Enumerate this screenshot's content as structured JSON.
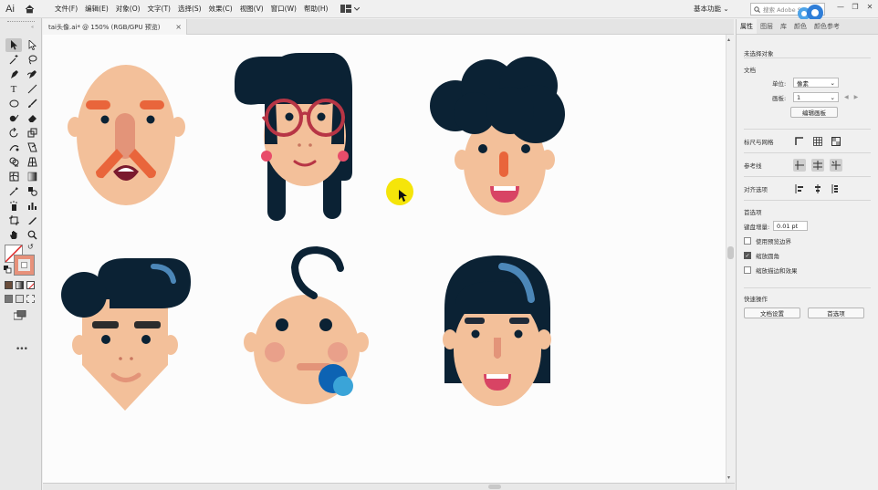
{
  "app": {
    "logo": "Ai"
  },
  "menu": [
    "文件(F)",
    "编辑(E)",
    "对象(O)",
    "文字(T)",
    "选择(S)",
    "效果(C)",
    "视图(V)",
    "窗口(W)",
    "帮助(H)"
  ],
  "workspace": {
    "label": "基本功能"
  },
  "search": {
    "placeholder": "搜索 Adobe Stock"
  },
  "document_tab": {
    "title": "tai头像.ai* @ 150% (RGB/GPU 预览)",
    "close": "×"
  },
  "panel": {
    "tabs": [
      "属性",
      "图层",
      "库",
      "颜色",
      "颜色参考"
    ],
    "selection_state": "未选择对象",
    "document": {
      "title": "文档",
      "units_label": "单位:",
      "units_value": "像素",
      "artboard_label": "画板:",
      "artboard_value": "1",
      "edit_artboards": "编辑画板"
    },
    "rulers_grids": "标尺与网格",
    "guides": "参考线",
    "align_to": "对齐选项",
    "preferences": {
      "title": "首选项",
      "key_increment_label": "键盘增量:",
      "key_increment_value": "0.01 pt",
      "use_preview_bounds": "使用预览边界",
      "scale_corners": "缩放圆角",
      "scale_strokes_effects": "缩放描边和效果"
    },
    "quick_actions": {
      "title": "快速操作",
      "document_setup": "文档设置",
      "preferences": "首选项"
    }
  },
  "colors": {
    "skin": "#f3c09a",
    "hair": "#0b2234",
    "accent_orange": "#e9653b",
    "nose": "#e39479",
    "glasses": "#b73545",
    "cheek": "#e84c6a",
    "mouth": "#d84464",
    "pacifier_blue": "#0d63b3",
    "pacifier_light": "#3aa4d8",
    "highlight": "#4c87b8",
    "cursor_highlight": "#f5e50a"
  }
}
